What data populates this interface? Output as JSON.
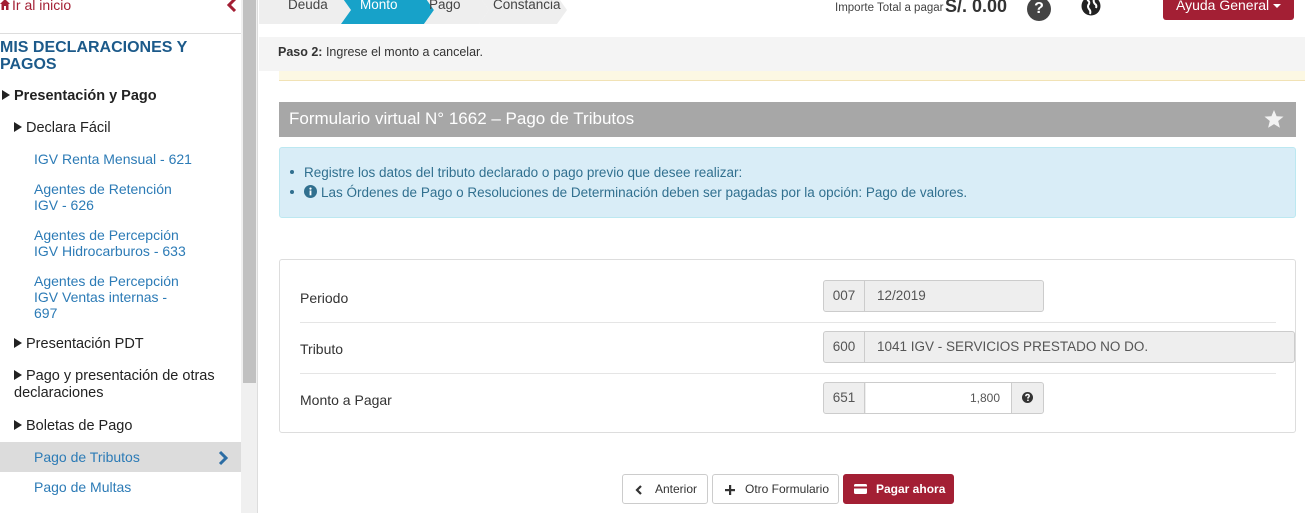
{
  "sidebar": {
    "home_link": "Ir al inicio",
    "title": "MIS DECLARACIONES Y PAGOS",
    "section": "Presentación y Pago",
    "declara_facil": "Declara Fácil",
    "items": [
      "IGV Renta Mensual - 621",
      "Agentes de Retención IGV - 626",
      "Agentes de Percepción IGV Hidrocarburos - 633",
      "Agentes de Percepción IGV Ventas internas - 697"
    ],
    "presentacion_pdt": "Presentación PDT",
    "pago_otras": "Pago y presentación de otras declaraciones",
    "boletas": "Boletas de Pago",
    "pago_tributos": "Pago de Tributos",
    "pago_multas": "Pago de Multas"
  },
  "steps": [
    {
      "label": "Deuda",
      "active": false
    },
    {
      "label": "Monto",
      "active": true
    },
    {
      "label": "Pago",
      "active": false
    },
    {
      "label": "Constancia",
      "active": false
    }
  ],
  "header": {
    "total_label": "Importe Total a pagar",
    "total_value": "S/. 0.00",
    "help_icon": "question-circle-icon",
    "globe_icon": "globe-icon",
    "ayuda_label": "Ayuda General"
  },
  "paso": {
    "bold": "Paso 2:",
    "text": " Ingrese el monto a cancelar."
  },
  "form": {
    "title": "Formulario virtual N° 1662 – Pago de Tributos",
    "info_1": "Registre los datos del tributo declarado o pago previo que desee realizar:",
    "info_2": "Las Órdenes de Pago o Resoluciones de Determinación deben ser pagadas por la opción: Pago de valores.",
    "rows": [
      {
        "label": "Periodo",
        "code": "007",
        "value": "12/2019"
      },
      {
        "label": "Tributo",
        "code": "600",
        "value": "1041 IGV - SERVICIOS PRESTADO NO DO."
      },
      {
        "label": "Monto a Pagar",
        "code": "651",
        "value": "1,800"
      }
    ]
  },
  "buttons": {
    "anterior": "Anterior",
    "otro": "Otro Formulario",
    "pagar": "Pagar ahora"
  },
  "colors": {
    "brand": "#a31f34",
    "link": "#2c7bb6",
    "step_active": "#17a2c9",
    "info_bg": "#d9edf7"
  }
}
